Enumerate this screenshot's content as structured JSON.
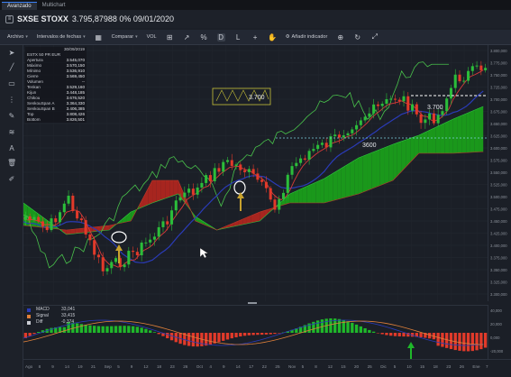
{
  "tabs": [
    "Avanzado",
    "Multichart"
  ],
  "header": {
    "symbol": "SXSE STOXX",
    "quote": "3.795,87988 0% 09/01/2020"
  },
  "toolbar": {
    "archivo": "Archivo",
    "intervalos": "Intervalos de fechas",
    "comparar": "Comparar",
    "volumen": "VOL",
    "d_label": "D",
    "l_label": "L",
    "anadir_indicador": "Añadir indicador"
  },
  "datatable": {
    "date": "30/09/2019",
    "instrument": "ESTX 50 PR EUR",
    "rows": [
      {
        "k": "Apertura",
        "v": "3.545,070"
      },
      {
        "k": "Máximo",
        "v": "3.570,150"
      },
      {
        "k": "Mínimo",
        "v": "3.536,910"
      },
      {
        "k": "Cierre",
        "v": "3.569,450"
      },
      {
        "k": "Volumen",
        "v": "--"
      },
      {
        "k": "Tenkan",
        "v": "3.529,160"
      },
      {
        "k": "Kijun",
        "v": "3.448,185"
      },
      {
        "k": "Chikou",
        "v": "3.676,520"
      },
      {
        "k": "SenkouSpan A",
        "v": "3.364,330"
      },
      {
        "k": "SenkouSpan B",
        "v": "3.406,385"
      },
      {
        "k": "Top",
        "v": "3.808,426"
      },
      {
        "k": "Bottom",
        "v": "3.826,501"
      }
    ]
  },
  "annotations": {
    "label_3700_a": "3.700",
    "label_3700_b": "3.700",
    "label_3600": "3600"
  },
  "price_axis": [
    "3.800,000",
    "3.775,000",
    "3.750,000",
    "3.725,000",
    "3.700,000",
    "3.675,000",
    "3.650,000",
    "3.625,000",
    "3.600,000",
    "3.575,000",
    "3.550,000",
    "3.525,000",
    "3.500,000",
    "3.475,000",
    "3.450,000",
    "3.425,000",
    "3.400,000",
    "3.375,000",
    "3.350,000",
    "3.325,000",
    "3.300,000"
  ],
  "macd": {
    "rows": [
      {
        "k": "MACD",
        "v": "33,041"
      },
      {
        "k": "Signal",
        "v": "33,415"
      },
      {
        "k": "Diff",
        "v": "-0,374"
      }
    ],
    "axis": [
      "40,000",
      "20,000",
      "0,000",
      "-20,000"
    ]
  },
  "xaxis": [
    "Ago",
    "8",
    "9",
    "14",
    "19",
    "21",
    "Sep",
    "5",
    "9",
    "12",
    "18",
    "23",
    "26",
    "Oct",
    "4",
    "9",
    "14",
    "17",
    "22",
    "25",
    "Nov",
    "5",
    "8",
    "12",
    "15",
    "20",
    "25",
    "Dic",
    "5",
    "10",
    "15",
    "18",
    "23",
    "26",
    "Ene",
    "7"
  ],
  "colors": {
    "cloud_bull": "#1aa31a",
    "cloud_bear": "#b3261e",
    "candle_up": "#2bbd3a",
    "candle_down": "#e23a2a",
    "tenkan": "#d83a3a",
    "kijun": "#2a3bb7",
    "chikou": "#49c24b",
    "annot_yellow": "#c9c33a",
    "arrow": "#c8a22d"
  }
}
